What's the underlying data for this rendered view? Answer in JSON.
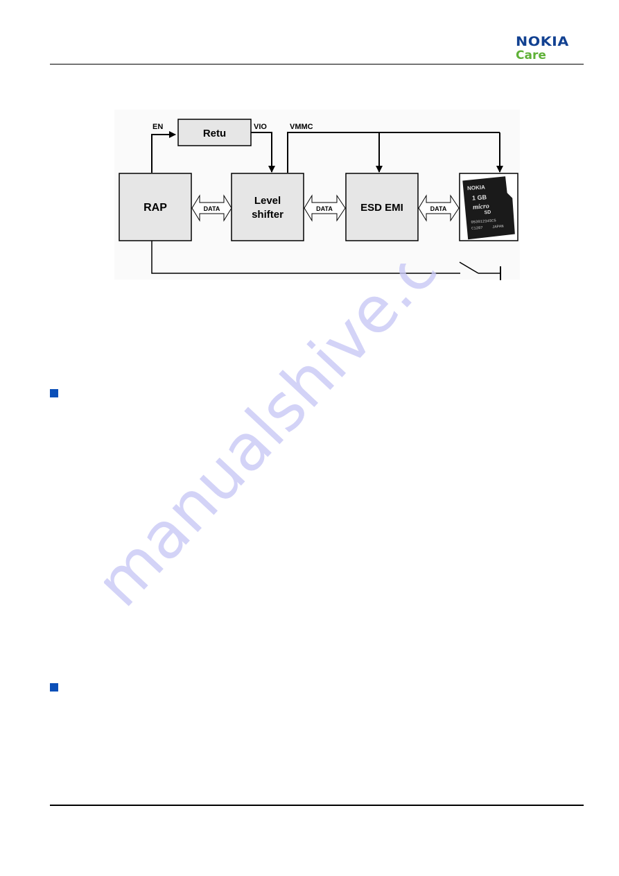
{
  "header": {
    "logo_brand": "NOKIA",
    "logo_sub": "Care",
    "brand_color": "#124191",
    "sub_color": "#5fb138"
  },
  "diagram": {
    "blocks": {
      "rap": "RAP",
      "retu": "Retu",
      "level_shifter_line1": "Level",
      "level_shifter_line2": "shifter",
      "esd_emi": "ESD EMI"
    },
    "signals": {
      "en": "EN",
      "vio": "VIO",
      "vmmc": "VMMC"
    },
    "data_arrows": [
      "DATA",
      "DATA",
      "DATA"
    ],
    "card": {
      "brand": "NOKIA",
      "capacity": "1 GB",
      "type_line1": "micro",
      "type_line2": "SD",
      "serial": "053012345C5",
      "code": "C1287",
      "origin": "JAPAN"
    }
  },
  "watermark": "manualshive.com",
  "bullet_color": "#0b4fb8"
}
